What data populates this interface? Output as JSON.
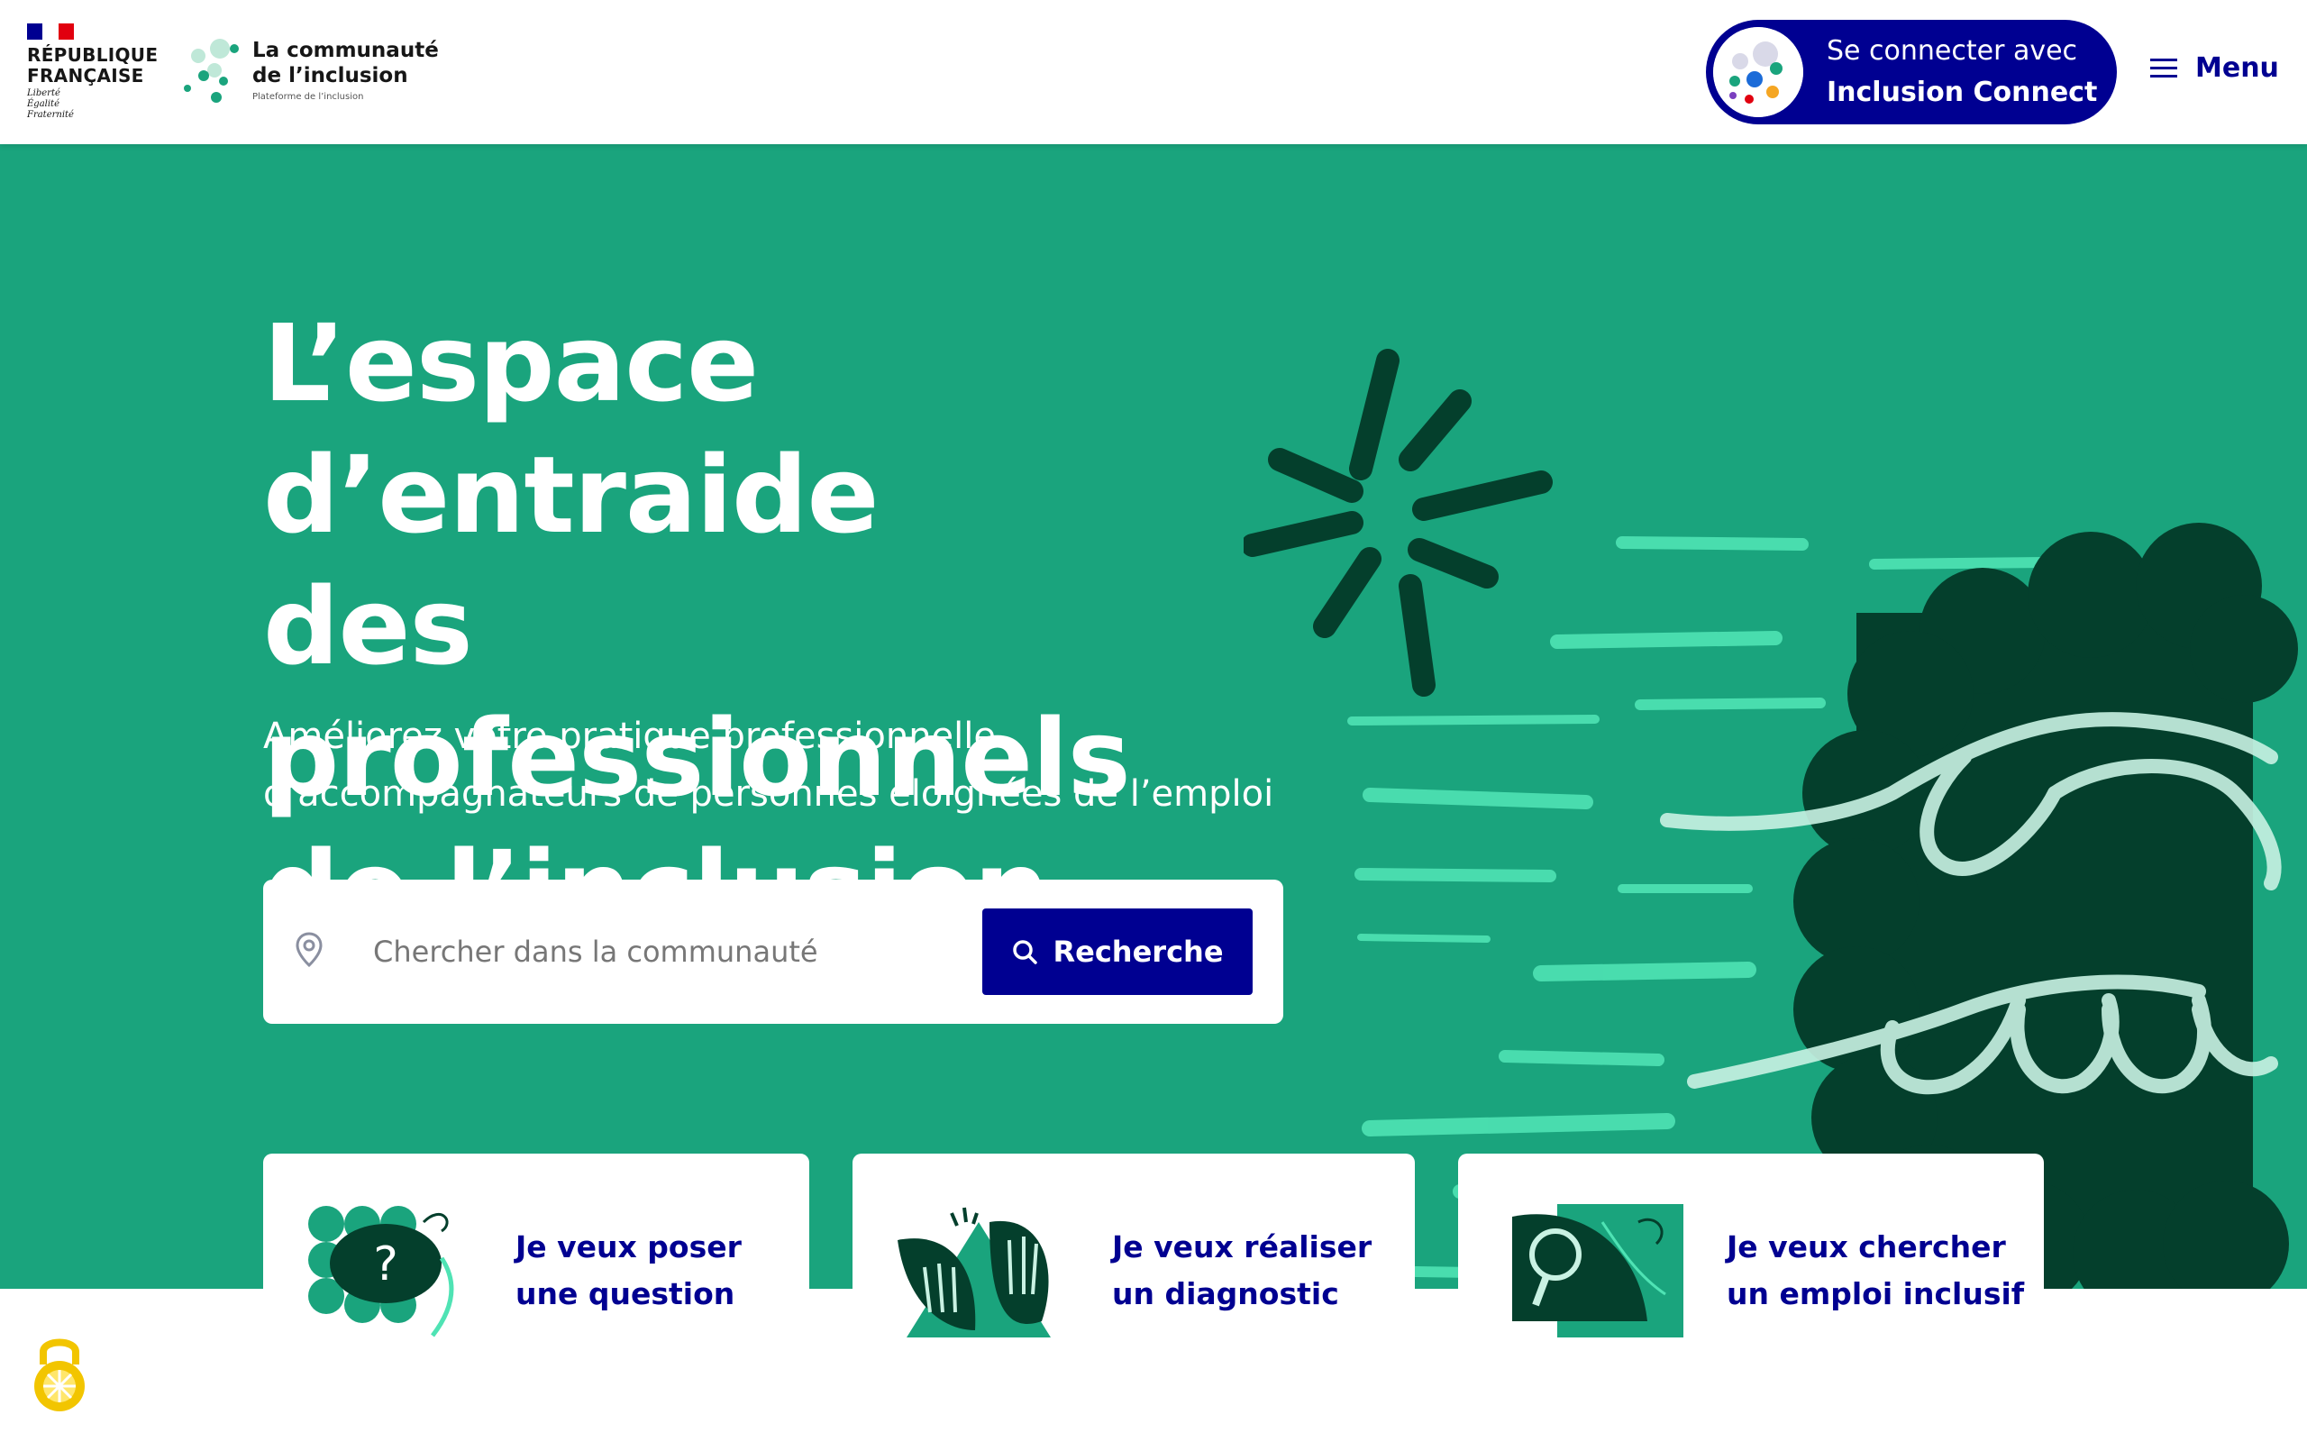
{
  "header": {
    "republique_line1": "RÉPUBLIQUE",
    "republique_line2": "FRANÇAISE",
    "motto": [
      "Liberté",
      "Égalité",
      "Fraternité"
    ],
    "brand_line1": "La communauté",
    "brand_line2": "de l’inclusion",
    "brand_sub": "Plateforme de l’inclusion",
    "connect_line1": "Se connecter avec",
    "connect_line2": "Inclusion Connect",
    "menu_label": "Menu"
  },
  "hero": {
    "title_lines": [
      "L’espace d’entraide",
      "des professionnels",
      "de l’inclusion"
    ],
    "subtitle_lines": [
      "Améliorez votre pratique professionnelle",
      "d’accompagnateurs de personnes éloignées de l’emploi"
    ]
  },
  "search": {
    "placeholder": "Chercher dans la communauté",
    "button_label": "Recherche"
  },
  "cards": [
    {
      "line1": "Je veux poser",
      "line2": "une question"
    },
    {
      "line1": "Je veux réaliser",
      "line2": "un diagnostic"
    },
    {
      "line1": "Je veux chercher",
      "line2": "un emploi inclusif"
    }
  ],
  "colors": {
    "hero_green": "#1aa47d",
    "dark_green": "#043f2c",
    "mint": "#4fe3b4",
    "primary_blue": "#000091",
    "flag_blue": "#000091",
    "flag_red": "#e1000f"
  },
  "icons": {
    "marianne": "marianne-flag-icon",
    "brand": "brand-dots-icon",
    "connect": "inclusion-connect-icon",
    "menu": "hamburger-menu-icon",
    "search_pin": "location-pin-icon",
    "search_button": "search-icon",
    "a11y": "accessibility-lock-icon"
  }
}
